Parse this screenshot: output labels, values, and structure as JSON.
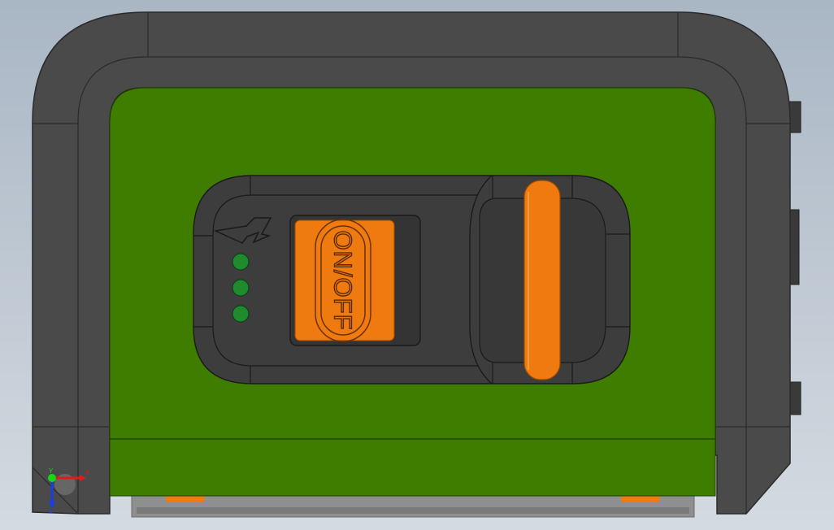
{
  "viewport": {
    "background_top": "#a9b6c4",
    "background_bottom": "#d4dae1"
  },
  "model": {
    "frame_color": "#4a4a4a",
    "frame_edge_color": "#2a2a2a",
    "body_color": "#3f7d00",
    "panel_color": "#3d3d3d",
    "accent_color": "#ee7a10",
    "led_color": "#1f8a2e",
    "foot_color": "#8f8f8f"
  },
  "switch": {
    "label": "ON/OFF"
  },
  "icons": {
    "power": "lightning-bolt-icon"
  },
  "leds": {
    "count": 3
  },
  "triad": {
    "y_label": "Y",
    "x_label": "X",
    "z_label": "Z",
    "x_color": "#e01b1b",
    "y_color": "#18d618",
    "z_color": "#1a3ee6"
  }
}
